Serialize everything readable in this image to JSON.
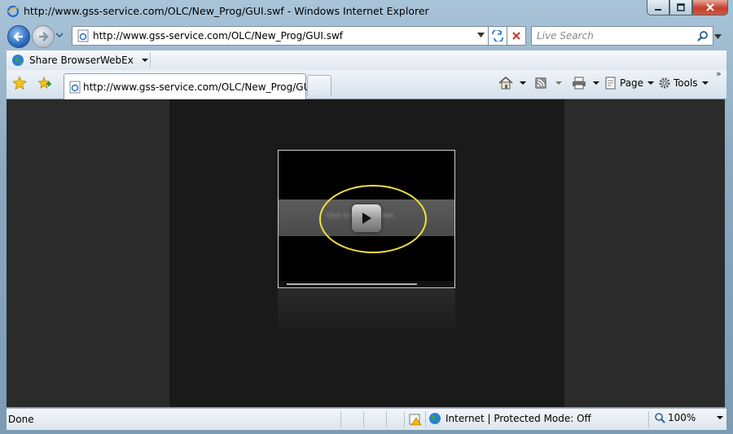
{
  "window": {
    "title": "http://www.gss-service.com/OLC/New_Prog/GUI.swf - Windows Internet Explorer",
    "controls": {
      "minimize": "minimize-icon",
      "maximize": "maximize-icon",
      "close": "close-icon"
    }
  },
  "navbar": {
    "address": "http://www.gss-service.com/OLC/New_Prog/GUI.swf",
    "search_placeholder": "Live Search"
  },
  "linksbar": {
    "items": [
      {
        "label": "Share Browser",
        "icon": "globe-icon"
      },
      {
        "label": "WebEx",
        "icon": "chevron-down-icon"
      }
    ]
  },
  "tabs": [
    {
      "label": "http://www.gss-service.com/OLC/New_Prog/GU...",
      "active": true
    }
  ],
  "commandbar": {
    "page_label": "Page",
    "tools_label": "Tools",
    "overflow": "»"
  },
  "player": {
    "band_text": "Click to play / restart"
  },
  "statusbar": {
    "status": "Done",
    "zone": "Internet | Protected Mode: Off",
    "zoom": "100%"
  },
  "colors": {
    "highlight_ellipse": "#f0e03a",
    "page_background": "#2b2b2b",
    "stage_background": "#1a1a1a"
  }
}
